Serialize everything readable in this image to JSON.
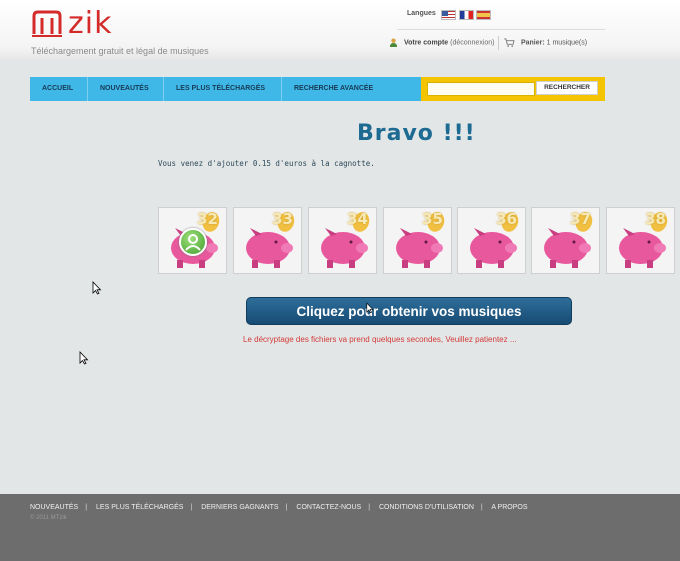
{
  "header": {
    "logo_text": "zik",
    "tagline": "Téléchargement gratuit et légal de musiques",
    "languages_label": "Langues",
    "account_label": "Votre compte",
    "logout_label": "(déconnexion)",
    "cart_label": "Panier:",
    "cart_value": "1 musique(s)"
  },
  "nav": {
    "items": [
      "ACCUEIL",
      "NOUVEAUTÉS",
      "LES PLUS TÉLÉCHARGÉS",
      "RECHERCHE AVANCÉE"
    ],
    "search_button": "RECHERCHER",
    "search_value": ""
  },
  "main": {
    "title": "Bravo !!!",
    "added_message": "Vous venez d'ajouter 0.15 d'euros à la cagnotte.",
    "piggy_numbers": [
      "32",
      "33",
      "34",
      "35",
      "36",
      "37",
      "38"
    ],
    "cta_label": "Cliquez pour obtenir vos musiques",
    "decrypt_message": "Le décryptage des fichiers va prend quelques secondes, Veuillez patientez ..."
  },
  "footer": {
    "links": [
      "NOUVEAUTÉS",
      "LES PLUS TÉLÉCHARGÉS",
      "DERNIERS GAGNANTS",
      "CONTACTEZ-NOUS",
      "CONDITIONS D'UTILISATION",
      "A PROPOS"
    ],
    "copyright": "© 2011 MTzik"
  },
  "colors": {
    "accent_blue": "#3fb8e8",
    "search_yellow": "#f4c400",
    "title_blue": "#1d6a93",
    "logo_red": "#d42a2a",
    "piggy_pink": "#e8589c"
  }
}
